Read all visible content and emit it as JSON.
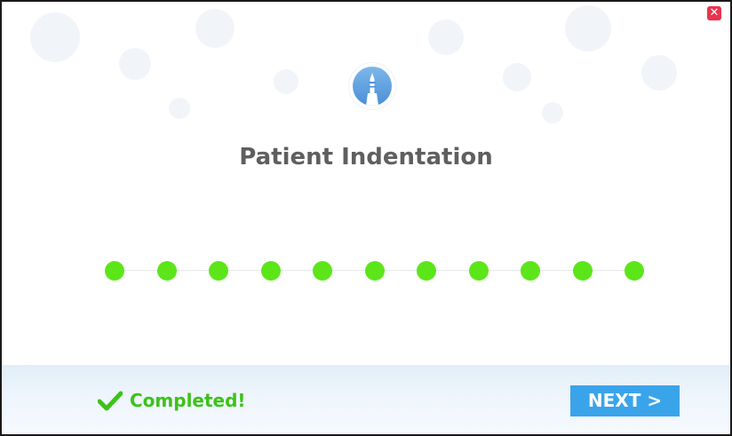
{
  "dialog": {
    "close_icon": "close-icon",
    "close_glyph": "✕",
    "logo_icon": "pen-tip-icon",
    "title": "Patient Indentation"
  },
  "progress": {
    "total_steps": 11,
    "completed_steps": 11,
    "dot_color": "#5ce61a"
  },
  "footer": {
    "status_icon": "checkmark-icon",
    "status_text": "Completed!",
    "next_label": "NEXT >"
  },
  "colors": {
    "close": "#e8344f",
    "accent": "#3aa4ea",
    "success": "#3cc21a",
    "title": "#5f5f5f"
  }
}
